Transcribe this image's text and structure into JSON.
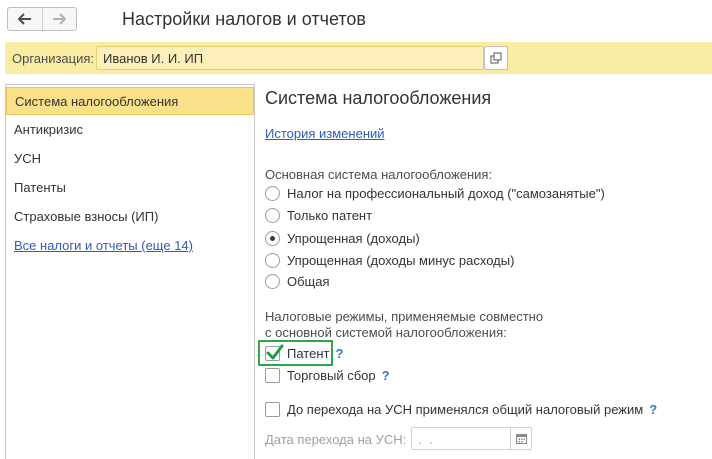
{
  "window": {
    "title": "Настройки налогов и отчетов"
  },
  "organization": {
    "label": "Организация:",
    "value": "Иванов И. И. ИП"
  },
  "sidebar": {
    "items": [
      {
        "label": "Система налогообложения",
        "active": true
      },
      {
        "label": "Антикризис"
      },
      {
        "label": "УСН"
      },
      {
        "label": "Патенты"
      },
      {
        "label": "Страховые взносы (ИП)"
      },
      {
        "label": "Все налоги и отчеты (еще 14)",
        "link": true
      }
    ]
  },
  "main": {
    "section_title": "Система налогообложения",
    "history_link": "История изменений",
    "tax_system": {
      "label": "Основная система налогообложения:",
      "options": [
        {
          "label": "Налог на профессиональный доход (\"самозанятые\")",
          "selected": false
        },
        {
          "label": "Только патент",
          "selected": false
        },
        {
          "label": "Упрощенная (доходы)",
          "selected": true
        },
        {
          "label": "Упрощенная (доходы минус расходы)",
          "selected": false
        },
        {
          "label": "Общая",
          "selected": false
        }
      ]
    },
    "combined_regimes": {
      "label_line1": "Налоговые режимы, применяемые совместно",
      "label_line2": "с основной системой налогообложения:",
      "patent": {
        "label": "Патент",
        "checked": true,
        "help": "?"
      },
      "trade_fee": {
        "label": "Торговый сбор",
        "checked": false,
        "help": "?"
      }
    },
    "prior_general": {
      "label": "До перехода на УСН применялся общий налоговый режим",
      "checked": false,
      "help": "?"
    },
    "transition_date": {
      "label": "Дата перехода на УСН:",
      "value": ". ."
    }
  },
  "colors": {
    "org_bar": "#fbeca3",
    "active_item": "#fbe08a",
    "link": "#2d5db8",
    "help": "#3b78c4",
    "highlight": "#2aa84a",
    "checkmark": "#1f9a45"
  }
}
